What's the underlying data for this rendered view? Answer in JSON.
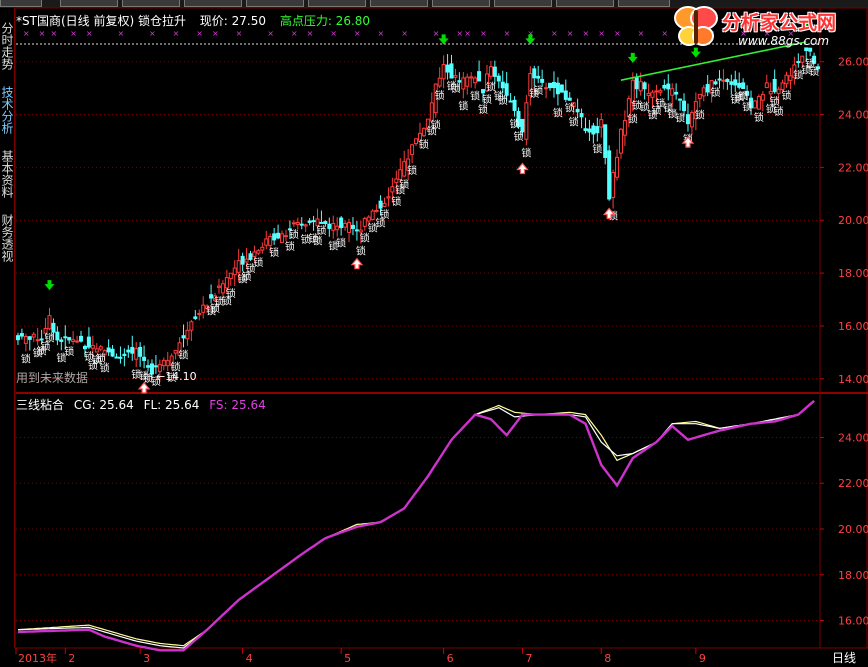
{
  "header": {
    "title": "*ST国商(日线 前复权) 锁仓拉升",
    "price_label": "现价: 27.50",
    "resistance_label": "高点压力: 26.80"
  },
  "side_tabs": [
    "分时走势",
    "技术分析",
    "基本资料",
    "财务透视"
  ],
  "logo": {
    "title": "分析家公式网",
    "url": "www.88gs.com"
  },
  "upper": {
    "y_ticks": [
      "26.00",
      "24.00",
      "22.00",
      "20.00",
      "18.00",
      "16.00",
      "14.00"
    ],
    "future_note": "用到未来数据",
    "low_label": "14.10",
    "lock_char": "锁"
  },
  "lower": {
    "indicator_name": "三线粘合",
    "cg_label": "CG: 25.64",
    "fl_label": "FL: 25.64",
    "fs_label": "FS: 25.64",
    "y_ticks": [
      "24.00",
      "22.00",
      "20.00",
      "18.00",
      "16.00"
    ]
  },
  "x_axis": {
    "labels": [
      "2013年",
      "2",
      "3",
      "4",
      "5",
      "6",
      "7",
      "8",
      "9"
    ],
    "period": "日线"
  },
  "colors": {
    "bg": "#000000",
    "up": "#ff3a3a",
    "down": "#54ffff",
    "grid": "#7a0000",
    "fs": "#cc33cc",
    "cg": "#ffffff",
    "fl": "#ffff99",
    "arrow_down": "#00dd00",
    "arrow_up": "#ff5555"
  },
  "chart_data": [
    {
      "type": "candlestick",
      "title": "*ST国商(日线 前复权) 锁仓拉升",
      "ylim": [
        13.5,
        27.2
      ],
      "y_ticks": [
        14,
        16,
        18,
        20,
        22,
        24,
        26
      ],
      "anchors": [
        [
          0,
          15.6
        ],
        [
          6,
          15.6
        ],
        [
          8,
          16.3
        ],
        [
          10,
          15.5
        ],
        [
          16,
          15.4
        ],
        [
          22,
          15.1
        ],
        [
          26,
          14.8
        ],
        [
          30,
          15.0
        ],
        [
          34,
          14.4
        ],
        [
          40,
          15.0
        ],
        [
          44,
          16.2
        ],
        [
          48,
          16.9
        ],
        [
          52,
          17.6
        ],
        [
          56,
          18.4
        ],
        [
          60,
          18.8
        ],
        [
          64,
          19.3
        ],
        [
          68,
          19.6
        ],
        [
          72,
          19.8
        ],
        [
          76,
          20.0
        ],
        [
          80,
          19.7
        ],
        [
          84,
          20.0
        ],
        [
          86,
          19.5
        ],
        [
          88,
          20.1
        ],
        [
          92,
          20.5
        ],
        [
          96,
          21.5
        ],
        [
          100,
          22.8
        ],
        [
          104,
          23.8
        ],
        [
          106,
          25.0
        ],
        [
          108,
          25.8
        ],
        [
          112,
          25.2
        ],
        [
          116,
          25.4
        ],
        [
          118,
          25.0
        ],
        [
          120,
          25.8
        ],
        [
          124,
          24.8
        ],
        [
          128,
          23.2
        ],
        [
          130,
          25.7
        ],
        [
          132,
          25.2
        ],
        [
          136,
          25.0
        ],
        [
          140,
          24.6
        ],
        [
          142,
          24.0
        ],
        [
          146,
          23.2
        ],
        [
          148,
          23.8
        ],
        [
          150,
          21.0
        ],
        [
          152,
          22.5
        ],
        [
          154,
          24.0
        ],
        [
          156,
          25.2
        ],
        [
          160,
          24.9
        ],
        [
          164,
          25.0
        ],
        [
          168,
          24.6
        ],
        [
          170,
          23.6
        ],
        [
          172,
          24.5
        ],
        [
          176,
          25.2
        ],
        [
          180,
          25.3
        ],
        [
          184,
          25.0
        ],
        [
          186,
          24.3
        ],
        [
          190,
          25.0
        ],
        [
          194,
          25.2
        ],
        [
          198,
          26.0
        ],
        [
          200,
          26.6
        ],
        [
          202,
          25.8
        ]
      ],
      "low_annotation": 14.1,
      "resistance": 26.8,
      "current_price": 27.5
    },
    {
      "type": "line",
      "title": "三线粘合",
      "ylim": [
        14.8,
        25.9
      ],
      "y_ticks": [
        16,
        18,
        20,
        22,
        24
      ],
      "series": [
        {
          "name": "CG",
          "values": [
            [
              0,
              15.6
            ],
            [
              18,
              15.7
            ],
            [
              22,
              15.5
            ],
            [
              30,
              15.1
            ],
            [
              36,
              14.9
            ],
            [
              42,
              14.8
            ],
            [
              48,
              15.6
            ],
            [
              56,
              16.9
            ],
            [
              64,
              17.9
            ],
            [
              72,
              18.9
            ],
            [
              78,
              19.6
            ],
            [
              86,
              20.1
            ],
            [
              92,
              20.3
            ],
            [
              98,
              20.9
            ],
            [
              104,
              22.3
            ],
            [
              110,
              23.9
            ],
            [
              116,
              25.0
            ],
            [
              122,
              25.3
            ],
            [
              126,
              24.9
            ],
            [
              132,
              25.0
            ],
            [
              140,
              25.0
            ],
            [
              144,
              24.9
            ],
            [
              148,
              23.8
            ],
            [
              152,
              23.2
            ],
            [
              156,
              23.3
            ],
            [
              162,
              23.8
            ],
            [
              166,
              24.6
            ],
            [
              172,
              24.6
            ],
            [
              178,
              24.4
            ],
            [
              186,
              24.6
            ],
            [
              192,
              24.8
            ],
            [
              198,
              25.0
            ],
            [
              202,
              25.6
            ]
          ]
        },
        {
          "name": "FL",
          "values": [
            [
              0,
              15.6
            ],
            [
              18,
              15.8
            ],
            [
              22,
              15.6
            ],
            [
              30,
              15.2
            ],
            [
              36,
              15.0
            ],
            [
              42,
              14.9
            ],
            [
              48,
              15.6
            ],
            [
              56,
              16.9
            ],
            [
              64,
              17.9
            ],
            [
              72,
              18.9
            ],
            [
              78,
              19.6
            ],
            [
              86,
              20.2
            ],
            [
              92,
              20.3
            ],
            [
              98,
              20.9
            ],
            [
              104,
              22.3
            ],
            [
              110,
              23.9
            ],
            [
              116,
              25.0
            ],
            [
              122,
              25.4
            ],
            [
              126,
              25.1
            ],
            [
              132,
              25.0
            ],
            [
              140,
              25.1
            ],
            [
              144,
              25.0
            ],
            [
              148,
              24.1
            ],
            [
              152,
              23.0
            ],
            [
              156,
              23.3
            ],
            [
              162,
              23.8
            ],
            [
              166,
              24.6
            ],
            [
              172,
              24.7
            ],
            [
              178,
              24.4
            ],
            [
              186,
              24.6
            ],
            [
              192,
              24.8
            ],
            [
              198,
              25.0
            ],
            [
              202,
              25.6
            ]
          ]
        },
        {
          "name": "FS",
          "values": [
            [
              0,
              15.5
            ],
            [
              18,
              15.6
            ],
            [
              22,
              15.3
            ],
            [
              30,
              14.9
            ],
            [
              36,
              14.7
            ],
            [
              42,
              14.7
            ],
            [
              48,
              15.6
            ],
            [
              56,
              16.9
            ],
            [
              64,
              17.9
            ],
            [
              72,
              18.9
            ],
            [
              78,
              19.6
            ],
            [
              86,
              20.1
            ],
            [
              92,
              20.3
            ],
            [
              98,
              20.9
            ],
            [
              104,
              22.3
            ],
            [
              110,
              23.9
            ],
            [
              116,
              25.0
            ],
            [
              120,
              24.8
            ],
            [
              124,
              24.1
            ],
            [
              128,
              25.0
            ],
            [
              140,
              25.0
            ],
            [
              144,
              24.6
            ],
            [
              148,
              22.8
            ],
            [
              152,
              21.9
            ],
            [
              156,
              23.1
            ],
            [
              162,
              23.8
            ],
            [
              166,
              24.5
            ],
            [
              170,
              23.9
            ],
            [
              178,
              24.3
            ],
            [
              186,
              24.6
            ],
            [
              192,
              24.7
            ],
            [
              198,
              25.0
            ],
            [
              202,
              25.6
            ]
          ]
        }
      ]
    }
  ]
}
